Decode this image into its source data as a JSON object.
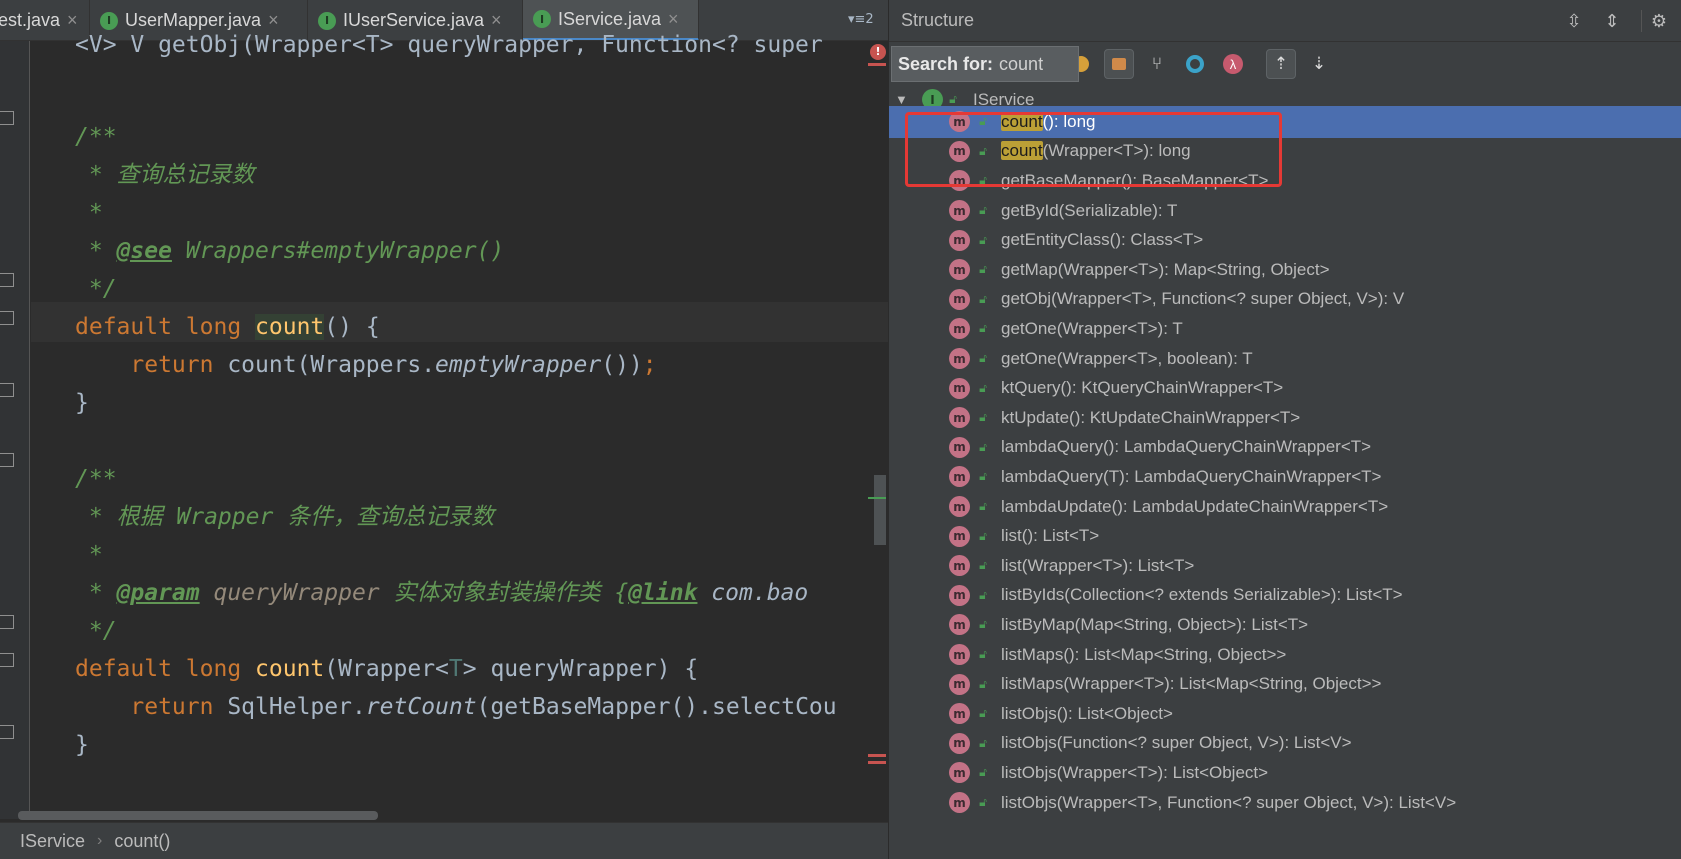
{
  "tabs": [
    {
      "label": "est.java",
      "icon": "interface-icon",
      "active": false
    },
    {
      "label": "UserMapper.java",
      "icon": "interface-icon",
      "active": false
    },
    {
      "label": "IUserService.java",
      "icon": "interface-icon",
      "active": false
    },
    {
      "label": "IService.java",
      "icon": "interface-icon",
      "active": true
    }
  ],
  "tab_overflow": "▾≡2",
  "code": {
    "line0": "<V> V getObj(Wrapper<T> queryWrapper, Function<? super",
    "c1_open": "/**",
    "c1_desc": " * 查询总记录数",
    "c1_star": " *",
    "c1_see_prefix": " * ",
    "c1_see_tag": "@see",
    "c1_see_ref": " Wrappers#emptyWrapper()",
    "c1_close": " */",
    "m1_kw1": "default",
    "m1_kw2": " long ",
    "m1_name": "count",
    "m1_rest": "() {",
    "m1_ret_kw": "return",
    "m1_ret_1": " count(Wrappers.",
    "m1_ret_it": "emptyWrapper",
    "m1_ret_2": "())",
    "m1_ret_semi": ";",
    "m1_end": "}",
    "c2_open": "/**",
    "c2_desc": " * 根据 Wrapper 条件，查询总记录数",
    "c2_star": " *",
    "c2_param_prefix": " * ",
    "c2_param_tag": "@param",
    "c2_param_name": " queryWrapper",
    "c2_param_desc": " 实体对象封装操作类 {",
    "c2_link_tag": "@link",
    "c2_link_ref": " com.bao",
    "c2_close": " */",
    "m2_kw1": "default",
    "m2_kw2": " long ",
    "m2_name": "count",
    "m2_rest_1": "(Wrapper<",
    "m2_T": "T",
    "m2_rest_2": "> queryWrapper) {",
    "m2_ret_kw": "return",
    "m2_ret_1": " SqlHelper.",
    "m2_ret_it": "retCount",
    "m2_ret_2": "(getBaseMapper().selectCou",
    "m2_end": "}"
  },
  "breadcrumb": [
    "IService",
    "count()"
  ],
  "structure": {
    "title": "Structure",
    "search_label": "Search for:",
    "search_value": "count",
    "root": "IService",
    "members": [
      {
        "match": "count",
        "rest": "(): long"
      },
      {
        "match": "count",
        "rest": "(Wrapper<T>): long"
      },
      {
        "match": "",
        "rest": "getBaseMapper(): BaseMapper<T>"
      },
      {
        "match": "",
        "rest": "getById(Serializable): T"
      },
      {
        "match": "",
        "rest": "getEntityClass(): Class<T>"
      },
      {
        "match": "",
        "rest": "getMap(Wrapper<T>): Map<String, Object>"
      },
      {
        "match": "",
        "rest": "getObj(Wrapper<T>, Function<? super Object, V>): V"
      },
      {
        "match": "",
        "rest": "getOne(Wrapper<T>): T"
      },
      {
        "match": "",
        "rest": "getOne(Wrapper<T>, boolean): T"
      },
      {
        "match": "",
        "rest": "ktQuery(): KtQueryChainWrapper<T>"
      },
      {
        "match": "",
        "rest": "ktUpdate(): KtUpdateChainWrapper<T>"
      },
      {
        "match": "",
        "rest": "lambdaQuery(): LambdaQueryChainWrapper<T>"
      },
      {
        "match": "",
        "rest": "lambdaQuery(T): LambdaQueryChainWrapper<T>"
      },
      {
        "match": "",
        "rest": "lambdaUpdate(): LambdaUpdateChainWrapper<T>"
      },
      {
        "match": "",
        "rest": "list(): List<T>"
      },
      {
        "match": "",
        "rest": "list(Wrapper<T>): List<T>"
      },
      {
        "match": "",
        "rest": "listByIds(Collection<? extends Serializable>): List<T>"
      },
      {
        "match": "",
        "rest": "listByMap(Map<String, Object>): List<T>"
      },
      {
        "match": "",
        "rest": "listMaps(): List<Map<String, Object>>"
      },
      {
        "match": "",
        "rest": "listMaps(Wrapper<T>): List<Map<String, Object>>"
      },
      {
        "match": "",
        "rest": "listObjs(): List<Object>"
      },
      {
        "match": "",
        "rest": "listObjs(Function<? super Object, V>): List<V>"
      },
      {
        "match": "",
        "rest": "listObjs(Wrapper<T>): List<Object>"
      },
      {
        "match": "",
        "rest": "listObjs(Wrapper<T>, Function<? super Object, V>): List<V>"
      }
    ]
  },
  "colors": {
    "selection": "#4b6eaf",
    "highlight_box": "#e53935",
    "search_match": "#bba036",
    "method_icon": "#c37286",
    "interface_icon": "#499c54"
  }
}
